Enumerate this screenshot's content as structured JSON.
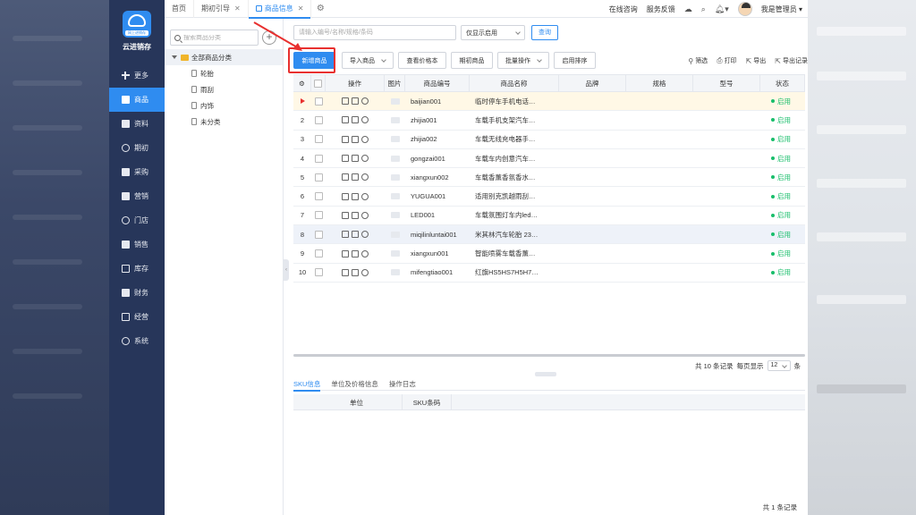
{
  "app": {
    "brand": "云进销存",
    "logo_tag": "网上进销存"
  },
  "sidebar": {
    "items": [
      {
        "label": "更多",
        "icon": "plus-icon"
      },
      {
        "label": "商品",
        "icon": "goods-icon",
        "active": true
      },
      {
        "label": "资料",
        "icon": "document-icon"
      },
      {
        "label": "期初",
        "icon": "clock-icon"
      },
      {
        "label": "采购",
        "icon": "cart-icon"
      },
      {
        "label": "营销",
        "icon": "marketing-icon"
      },
      {
        "label": "门店",
        "icon": "store-icon"
      },
      {
        "label": "销售",
        "icon": "sales-icon"
      },
      {
        "label": "库存",
        "icon": "warehouse-icon"
      },
      {
        "label": "财务",
        "icon": "finance-icon"
      },
      {
        "label": "经营",
        "icon": "business-icon"
      },
      {
        "label": "系统",
        "icon": "gear-icon"
      }
    ]
  },
  "tabs": [
    {
      "label": "首页",
      "closable": false
    },
    {
      "label": "期初引导",
      "closable": true
    },
    {
      "label": "商品信息",
      "closable": true,
      "active": true
    }
  ],
  "header": {
    "consult": "在线咨询",
    "feedback": "服务反馈",
    "user": "我是管理员"
  },
  "category": {
    "search_placeholder": "搜索商品分类",
    "root": "全部商品分类",
    "children": [
      "轮胎",
      "雨刮",
      "内饰",
      "未分类"
    ]
  },
  "filter": {
    "search_placeholder": "请输入编号/名称/规格/条码",
    "status": "仅显示启用",
    "query": "查询"
  },
  "toolbar": {
    "add": "新增商品",
    "import": "导入商品",
    "cost": "查看价格本",
    "initial": "期初商品",
    "batch": "批量操作",
    "sort": "启用排序",
    "filter": "筛选",
    "print": "打印",
    "export": "导出",
    "export_log": "导出记录"
  },
  "table": {
    "headers": {
      "op": "操作",
      "img": "图片",
      "code": "商品编号",
      "name": "商品名称",
      "brand": "品牌",
      "spec": "规格",
      "model": "型号",
      "status": "状态"
    },
    "rows": [
      {
        "no": "",
        "code": "baijian001",
        "name": "临时停车手机电话…",
        "status": "启用"
      },
      {
        "no": "2",
        "code": "zhijia001",
        "name": "车载手机支架汽车…",
        "status": "启用"
      },
      {
        "no": "3",
        "code": "zhijia002",
        "name": "车载无线充电器手…",
        "status": "启用"
      },
      {
        "no": "4",
        "code": "gongzai001",
        "name": "车载车内创意汽车…",
        "status": "启用"
      },
      {
        "no": "5",
        "code": "xiangxun002",
        "name": "车载香薰香氛香水…",
        "status": "启用"
      },
      {
        "no": "6",
        "code": "YUGUA001",
        "name": "适用别克凯越雨刮…",
        "status": "启用"
      },
      {
        "no": "7",
        "code": "LED001",
        "name": "车载氛围灯车内led…",
        "status": "启用"
      },
      {
        "no": "8",
        "code": "miqilinluntai001",
        "name": "米其林汽车轮胎 23…",
        "status": "启用"
      },
      {
        "no": "9",
        "code": "xiangxun001",
        "name": "智能喷雾车载香薰…",
        "status": "启用"
      },
      {
        "no": "10",
        "code": "mifengtiao001",
        "name": "红旗HS5HS7H5H7…",
        "status": "启用"
      }
    ]
  },
  "pager": {
    "total": "共 10 条记录",
    "per_page_label": "每页显示",
    "per_page": "12",
    "unit": "条"
  },
  "bottom": {
    "tabs": [
      "SKU信息",
      "单位及价格信息",
      "操作日志"
    ],
    "headers": {
      "unit": "单位",
      "sku": "SKU条码"
    },
    "footer": "共 1 条记录"
  }
}
